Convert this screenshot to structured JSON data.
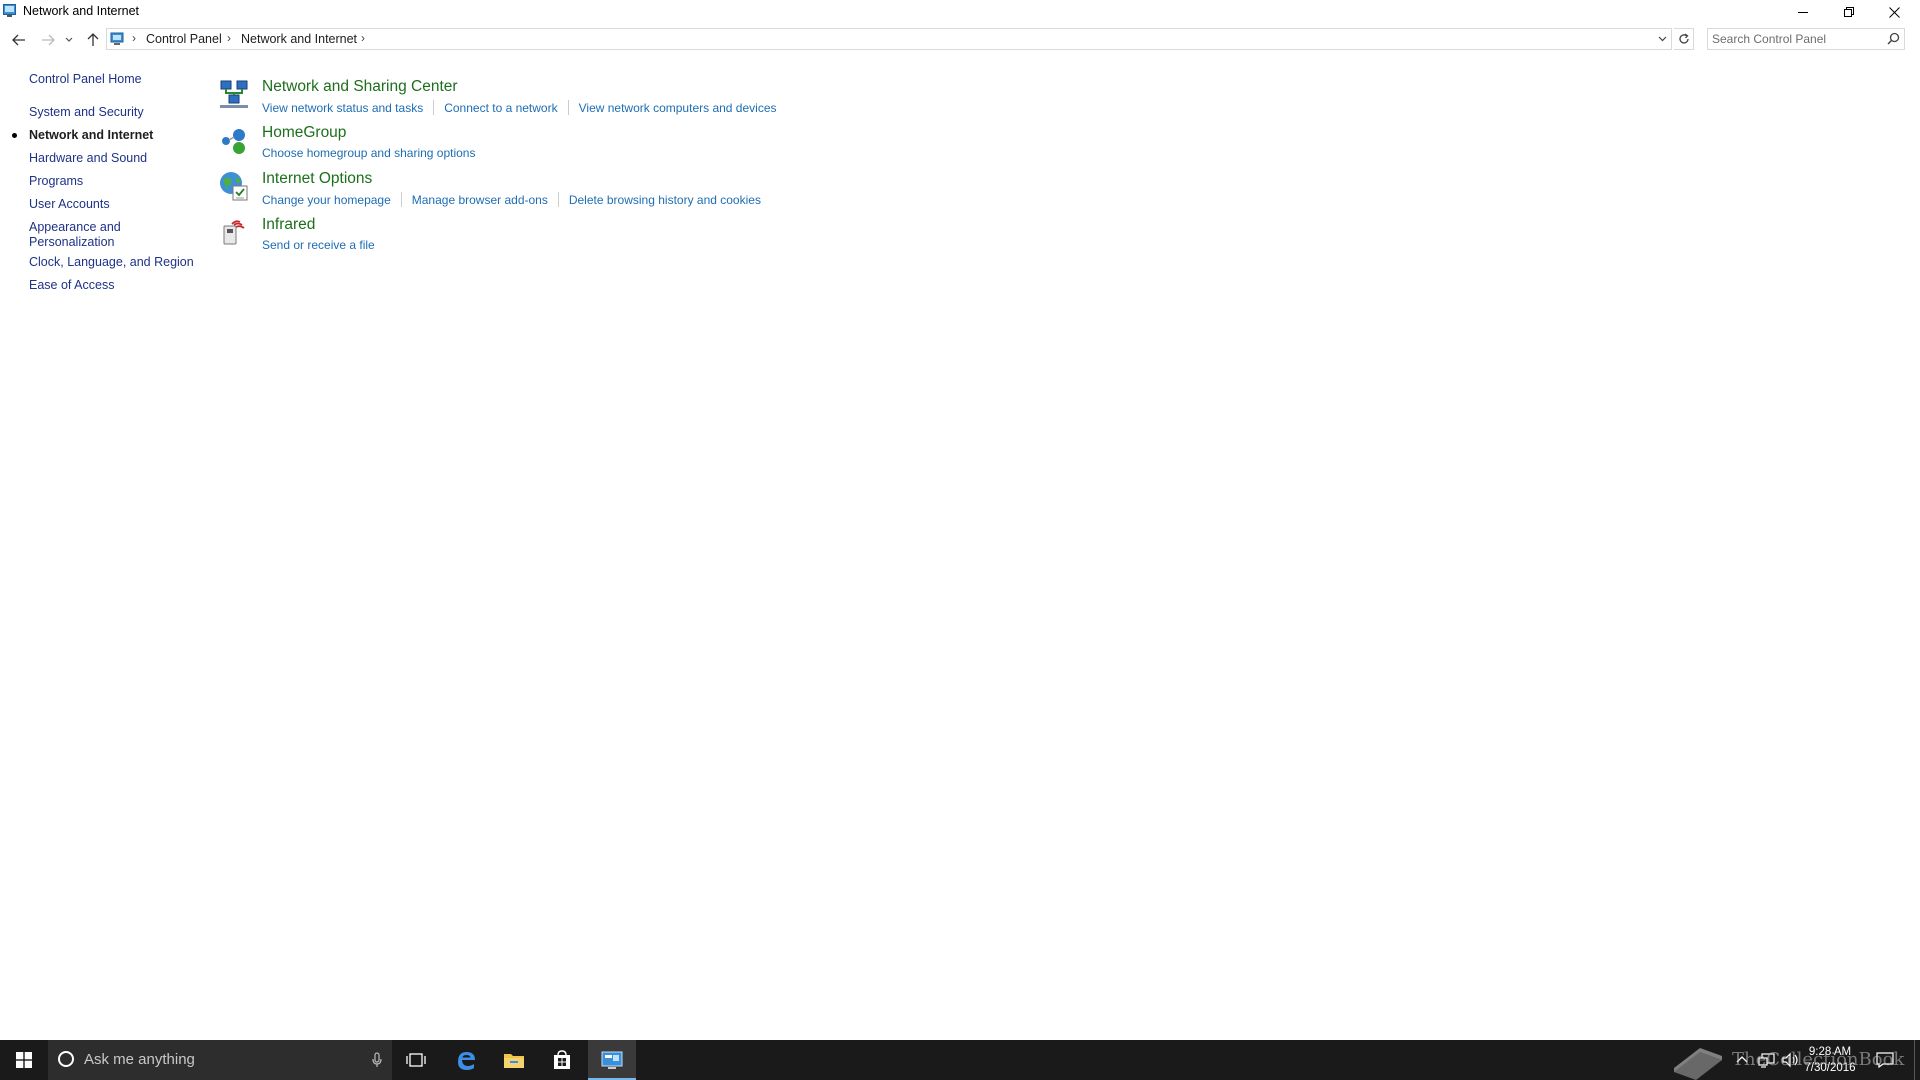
{
  "window": {
    "title": "Network and Internet",
    "controls": {
      "minimize": "minimize",
      "restore": "restore",
      "close": "close"
    }
  },
  "address": {
    "breadcrumbs": [
      "Control Panel",
      "Network and Internet"
    ],
    "search_placeholder": "Search Control Panel"
  },
  "sidebar": {
    "items": [
      {
        "label": "Control Panel Home",
        "current": false
      },
      {
        "label": "System and Security",
        "current": false
      },
      {
        "label": "Network and Internet",
        "current": true
      },
      {
        "label": "Hardware and Sound",
        "current": false
      },
      {
        "label": "Programs",
        "current": false
      },
      {
        "label": "User Accounts",
        "current": false
      },
      {
        "label": "Appearance and Personalization",
        "line1": "Appearance and",
        "line2": "Personalization",
        "current": false
      },
      {
        "label": "Clock, Language, and Region",
        "current": false
      },
      {
        "label": "Ease of Access",
        "current": false
      }
    ]
  },
  "categories": [
    {
      "title": "Network and Sharing Center",
      "icon": "network-sharing-center-icon",
      "tasks": [
        "View network status and tasks",
        "Connect to a network",
        "View network computers and devices"
      ]
    },
    {
      "title": "HomeGroup",
      "icon": "homegroup-icon",
      "tasks": [
        "Choose homegroup and sharing options"
      ]
    },
    {
      "title": "Internet Options",
      "icon": "internet-options-icon",
      "tasks": [
        "Change your homepage",
        "Manage browser add-ons",
        "Delete browsing history and cookies"
      ]
    },
    {
      "title": "Infrared",
      "icon": "infrared-icon",
      "tasks": [
        "Send or receive a file"
      ]
    }
  ],
  "taskbar": {
    "search_placeholder": "Ask me anything",
    "apps": [
      "task-view-icon",
      "edge-icon",
      "file-explorer-icon",
      "store-icon",
      "control-panel-icon"
    ],
    "clock": {
      "time": "9:28 AM",
      "date": "7/30/2016"
    },
    "watermark": "TheCollectionBook"
  },
  "colors": {
    "link": "#1e6db4",
    "category_title": "#1c6f1c",
    "nav_link": "#1e3287",
    "taskbar": "#1a1a1a",
    "taskbar_active_underline": "#76b9ed"
  }
}
